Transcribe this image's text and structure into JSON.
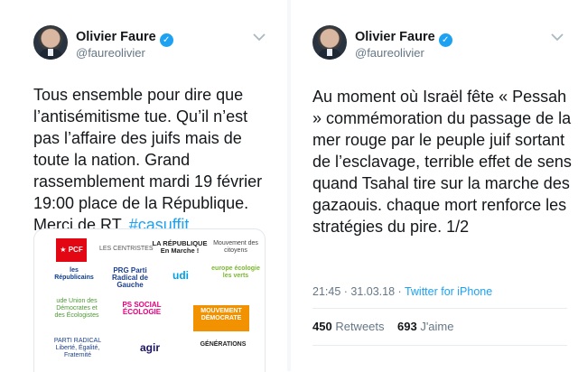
{
  "tweets": [
    {
      "author_name": "Olivier Faure",
      "author_handle": "@faureolivier",
      "text": "Tous ensemble pour dire que l’antisémitisme tue. Qu’il n’est pas l’affaire des juifs mais de toute la nation. Grand rassemblement mardi 19 février 19:00 place de la République. Merci de RT.",
      "hashtag": "#çasuffit",
      "logos": [
        {
          "label": "PCF",
          "icon": "pcf-star-icon",
          "color": "#e30613"
        },
        {
          "label": "LES CENTRISTES"
        },
        {
          "label": "LA RÉPUBLIQUE En Marche !"
        },
        {
          "label": "Mouvement des citoyens"
        },
        {
          "label": "les Républicains",
          "color": "#0b3d91"
        },
        {
          "label": "PRG Parti Radical de Gauche",
          "color": "#1b3f8b"
        },
        {
          "label": "udi",
          "color": "#00a0e3"
        },
        {
          "label": "europe écologie les verts",
          "color": "#78b82a"
        },
        {
          "label": "ude Union des Démocrates et des Écologistes",
          "color": "#6cbe45"
        },
        {
          "label": "PS SOCIAL ÉCOLOGIE",
          "color": "#e4007c"
        },
        {
          "label": "MOUVEMENT DÉMOCRATE",
          "color": "#f39200"
        },
        {
          "label": "PARTI RADICAL Liberté, Égalité, Fraternité",
          "color": "#1b3f8b"
        },
        {
          "label": "agir",
          "color": "#1b1464"
        },
        {
          "label": "GÉNÉRATIONS"
        }
      ]
    },
    {
      "author_name": "Olivier Faure",
      "author_handle": "@faureolivier",
      "text": "Au moment où Israël fête « Pessah » commémoration du passage de la mer rouge par le peuple juif sortant de l’esclavage, terrible effet de sens quand Tsahal tire sur la marche des gazaouis. chaque mort renforce les stratégies du pire. 1/2",
      "timestamp": "21:45 · 31.03.18 ·",
      "client": "Twitter for iPhone",
      "retweets_count": "450",
      "retweets_label": "Retweets",
      "likes_count": "693",
      "likes_label": "J'aime"
    }
  ],
  "colors": {
    "accent": "#1da1f2",
    "muted": "#657786",
    "text": "#14171a"
  }
}
